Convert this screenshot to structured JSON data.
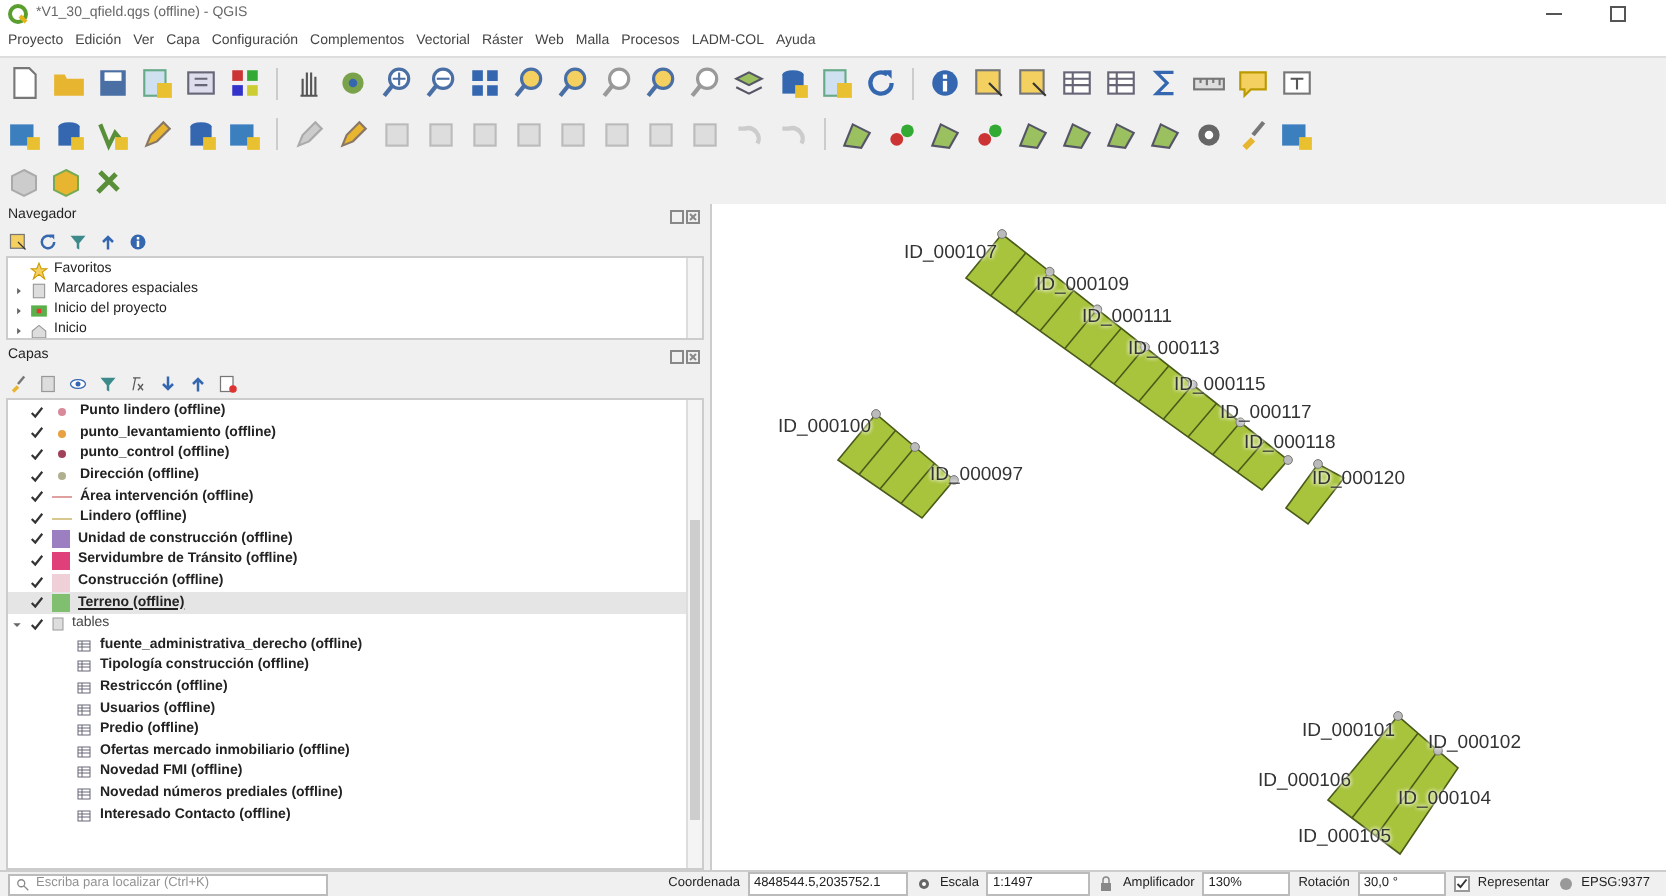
{
  "window": {
    "title": "*V1_30_qfield.qgs (offline) - QGIS"
  },
  "menu": [
    {
      "label": "Proyecto"
    },
    {
      "label": "Edición"
    },
    {
      "label": "Ver"
    },
    {
      "label": "Capa"
    },
    {
      "label": "Configuración"
    },
    {
      "label": "Complementos"
    },
    {
      "label": "Vectorial"
    },
    {
      "label": "Ráster"
    },
    {
      "label": "Web"
    },
    {
      "label": "Malla"
    },
    {
      "label": "Procesos"
    },
    {
      "label": "LADM-COL"
    },
    {
      "label": "Ayuda"
    }
  ],
  "browser": {
    "title": "Navegador",
    "items": [
      {
        "label": "Favoritos",
        "kind": "favorites",
        "expandable": false
      },
      {
        "label": "Marcadores espaciales",
        "kind": "bookmarks",
        "expandable": true
      },
      {
        "label": "Inicio del proyecto",
        "kind": "project",
        "expandable": true
      },
      {
        "label": "Inicio",
        "kind": "home",
        "expandable": true
      }
    ]
  },
  "layers": {
    "title": "Capas",
    "items": [
      {
        "label": "Punto lindero (offline)",
        "kind": "point",
        "color": "#d98a9a",
        "checked": true,
        "selected": false
      },
      {
        "label": "punto_levantamiento (offline)",
        "kind": "point",
        "color": "#e8a040",
        "checked": true,
        "selected": false
      },
      {
        "label": "punto_control (offline)",
        "kind": "point",
        "color": "#a0405a",
        "checked": true,
        "selected": false
      },
      {
        "label": "Dirección (offline)",
        "kind": "point",
        "color": "#b0b090",
        "checked": true,
        "selected": false
      },
      {
        "label": "Área intervención (offline)",
        "kind": "line",
        "color": "#e0a0a0",
        "checked": true,
        "selected": false
      },
      {
        "label": "Lindero (offline)",
        "kind": "line",
        "color": "#d8c890",
        "checked": true,
        "selected": false
      },
      {
        "label": "Unidad de construcción (offline)",
        "kind": "fill",
        "color": "#9b7fc0",
        "checked": true,
        "selected": false
      },
      {
        "label": "Servidumbre de Tránsito (offline)",
        "kind": "fill",
        "color": "#e0407a",
        "checked": true,
        "selected": false
      },
      {
        "label": "Construcción (offline)",
        "kind": "fill",
        "color": "#f0d0d8",
        "checked": true,
        "selected": false
      },
      {
        "label": "Terreno (offline)",
        "kind": "fill",
        "color": "#7fbf6f",
        "checked": true,
        "selected": true
      },
      {
        "label": "tables",
        "kind": "group",
        "checked": true,
        "expanded": true,
        "selected": false,
        "children": [
          {
            "label": "fuente_administrativa_derecho (offline)"
          },
          {
            "label": "Tipología construcción (offline)"
          },
          {
            "label": "Restriccón (offline)"
          },
          {
            "label": "Usuarios (offline)"
          },
          {
            "label": "Predio (offline)"
          },
          {
            "label": "Ofertas mercado inmobiliario (offline)"
          },
          {
            "label": "Novedad FMI (offline)"
          },
          {
            "label": "Novedad números prediales (offline)"
          },
          {
            "label": "Interesado Contacto (offline)"
          }
        ]
      }
    ]
  },
  "map": {
    "labels": [
      "ID_000107",
      "ID_000109",
      "ID_000111",
      "ID_000113",
      "ID_000115",
      "ID_000117",
      "ID_000118",
      "ID_000120",
      "ID_000100",
      "ID_000097",
      "ID_000101",
      "ID_000102",
      "ID_000106",
      "ID_000104",
      "ID_000105"
    ]
  },
  "status_bar": {
    "locator": {
      "placeholder": "Escriba para localizar (Ctrl+K)"
    },
    "coordinate_label": "Coordenada",
    "coordinate": "4848544.5,2035752.1",
    "scale_label": "Escala",
    "scale": "1:1497",
    "magnifier_label": "Amplificador",
    "magnifier": "130%",
    "rotation_label": "Rotación",
    "rotation": "30,0 °",
    "render": {
      "label": "Representar",
      "checked": true
    },
    "crs": "EPSG:9377"
  }
}
